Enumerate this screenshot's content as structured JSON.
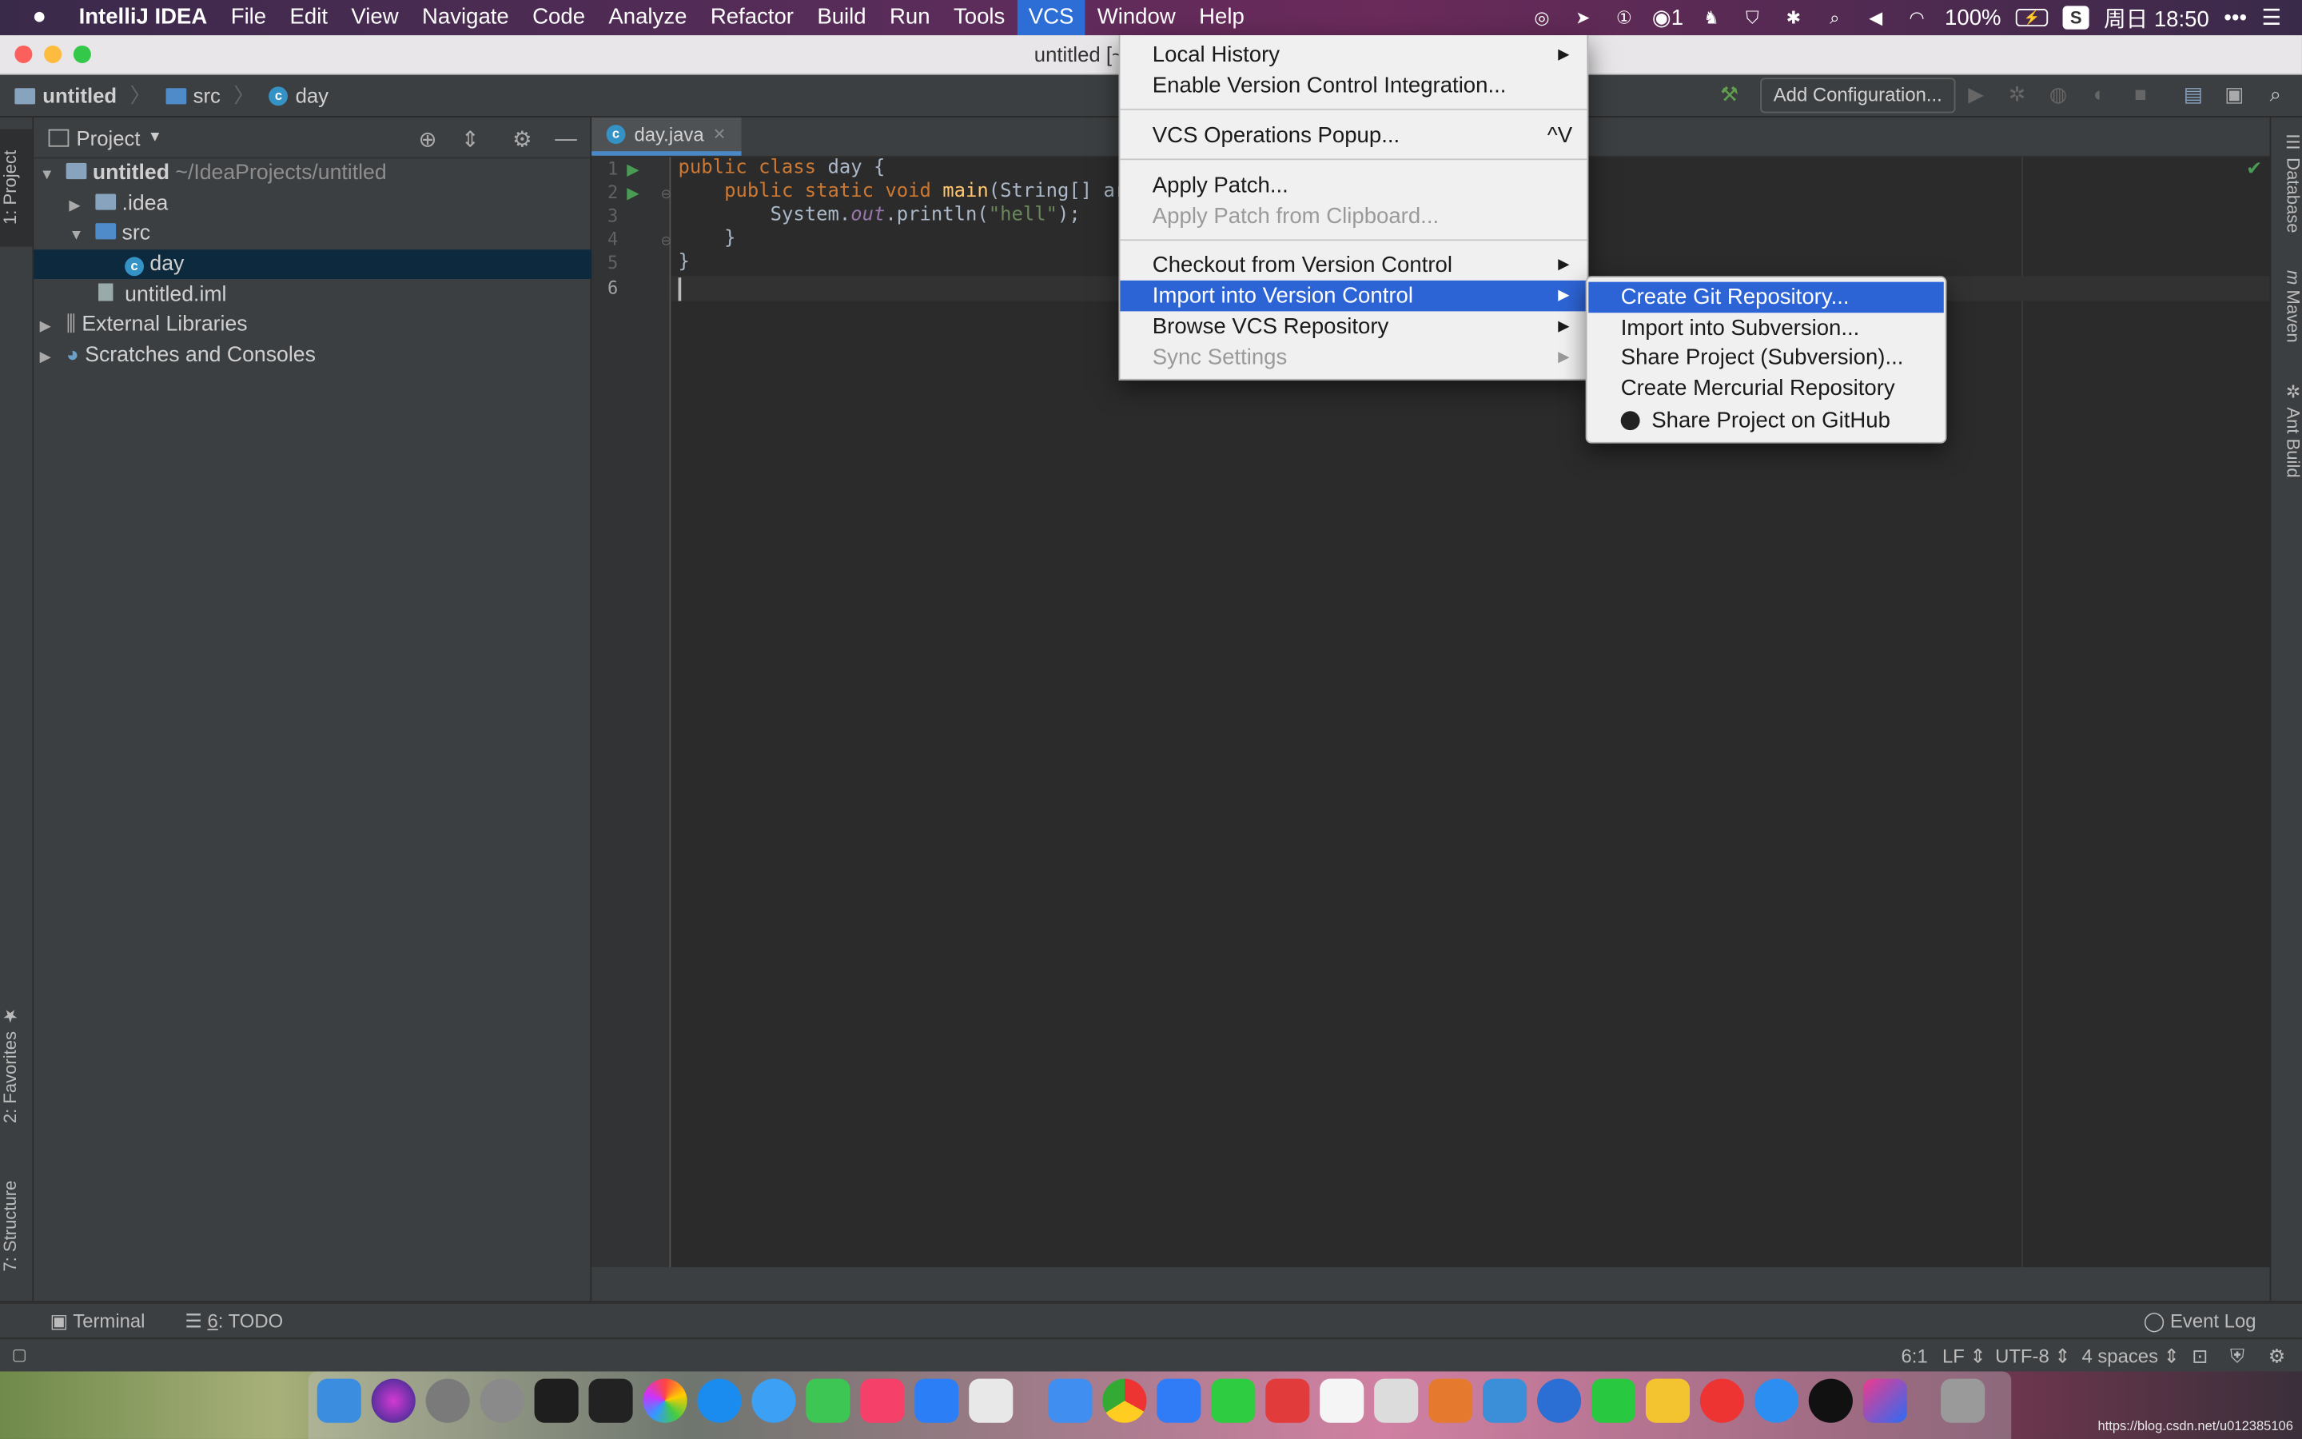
{
  "menubar": {
    "apple": "",
    "app": "IntelliJ IDEA",
    "items": [
      "File",
      "Edit",
      "View",
      "Navigate",
      "Code",
      "Analyze",
      "Refactor",
      "Build",
      "Run",
      "Tools",
      "VCS",
      "Window",
      "Help"
    ],
    "active": "VCS",
    "badge_count": "1",
    "battery": "100%",
    "clock": "周日 18:50"
  },
  "window": {
    "title": "untitled [~/IdeaProjects/ur"
  },
  "navbar": {
    "crumbs": [
      "untitled",
      "src",
      "day"
    ],
    "add_configuration": "Add Configuration..."
  },
  "project_panel": {
    "title": "Project",
    "tree": [
      {
        "label": "untitled",
        "hint": "~/IdeaProjects/untitled",
        "bold": true
      },
      {
        "label": ".idea"
      },
      {
        "label": "src"
      },
      {
        "label": "day",
        "selected": true
      },
      {
        "label": "untitled.iml"
      },
      {
        "label": "External Libraries"
      },
      {
        "label": "Scratches and Consoles"
      }
    ]
  },
  "left_tabs": {
    "project": "1: Project",
    "favorites": "2: Favorites",
    "structure": "7: Structure"
  },
  "right_tabs": {
    "database": "Database",
    "maven": "Maven",
    "ant": "Ant Build"
  },
  "editor": {
    "tab": "day.java",
    "line_numbers": [
      "1",
      "2",
      "3",
      "4",
      "5",
      "6"
    ],
    "code": {
      "l1_kw": "public class ",
      "l1_rest": "day {",
      "l2_kw": "public static void ",
      "l2_fn": "main",
      "l2_rest": "(String[] arg",
      "l3_a": "System.",
      "l3_out": "out",
      "l3_b": ".println(",
      "l3_str": "\"hell\"",
      "l3_c": ");",
      "l4": "}",
      "l5": "}"
    }
  },
  "bottom_tools": {
    "terminal": "Terminal",
    "todo_num": "6",
    "todo": ": TODO",
    "event_log": "Event Log"
  },
  "status": {
    "position": "6:1",
    "line_sep": "LF",
    "encoding": "UTF-8",
    "indent": "4 spaces"
  },
  "vcs_menu": {
    "items": [
      {
        "label": "Local History",
        "submenu": true
      },
      {
        "label": "Enable Version Control Integration..."
      },
      {
        "label": "VCS Operations Popup...",
        "shortcut": "^V"
      },
      {
        "label": "Apply Patch..."
      },
      {
        "label": "Apply Patch from Clipboard...",
        "disabled": true
      },
      {
        "label": "Checkout from Version Control",
        "submenu": true
      },
      {
        "label": "Import into Version Control",
        "submenu": true,
        "highlighted": true
      },
      {
        "label": "Browse VCS Repository",
        "submenu": true
      },
      {
        "label": "Sync Settings",
        "submenu": true,
        "disabled": true
      }
    ]
  },
  "import_submenu": {
    "items": [
      {
        "label": "Create Git Repository...",
        "highlighted": true
      },
      {
        "label": "Import into Subversion..."
      },
      {
        "label": "Share Project (Subversion)..."
      },
      {
        "label": "Create Mercurial Repository"
      },
      {
        "label": "Share Project on GitHub",
        "icon": "github-icon"
      }
    ]
  },
  "watermark": "https://blog.csdn.net/u012385106"
}
